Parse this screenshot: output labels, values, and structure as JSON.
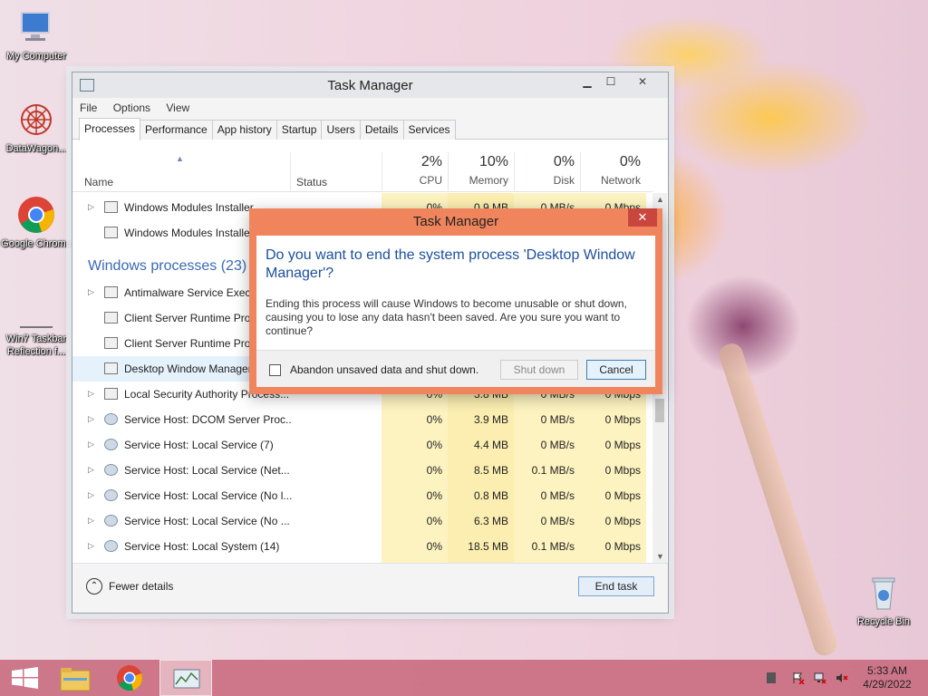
{
  "desktop": {
    "icons": [
      {
        "label": "My Computer",
        "icon": "computer-icon"
      },
      {
        "label": "DataWagon...",
        "icon": "datawagon-icon"
      },
      {
        "label": "Google Chrome",
        "icon": "chrome-icon"
      },
      {
        "label": "Win7 Taskbar Reflection f...",
        "icon": "shortcut-icon"
      },
      {
        "label": "Recycle Bin",
        "icon": "recycle-bin-icon"
      }
    ]
  },
  "taskmanager": {
    "title": "Task Manager",
    "window_buttons": {
      "minimize": "▁",
      "maximize": "☐",
      "close": "✕"
    },
    "menu": [
      "File",
      "Options",
      "View"
    ],
    "tabs": [
      "Processes",
      "Performance",
      "App history",
      "Startup",
      "Users",
      "Details",
      "Services"
    ],
    "active_tab": "Processes",
    "columns": {
      "name": "Name",
      "status": "Status",
      "cpu": {
        "pct": "2%",
        "label": "CPU"
      },
      "memory": {
        "pct": "10%",
        "label": "Memory"
      },
      "disk": {
        "pct": "0%",
        "label": "Disk"
      },
      "network": {
        "pct": "0%",
        "label": "Network"
      }
    },
    "group_header": "Windows processes (23)",
    "rows": [
      {
        "name": "Windows Modules Installer",
        "expand": "▷",
        "cpu": "0%",
        "mem": "0.9 MB",
        "disk": "0 MB/s",
        "net": "0 Mbps"
      },
      {
        "name": "Windows Modules Installer",
        "expand": "",
        "cpu": "",
        "mem": "",
        "disk": "",
        "net": ""
      },
      {
        "name": "Antimalware Service Executable",
        "expand": "▷",
        "cpu": "",
        "mem": "",
        "disk": "",
        "net": ""
      },
      {
        "name": "Client Server Runtime Process",
        "expand": "",
        "cpu": "",
        "mem": "",
        "disk": "",
        "net": ""
      },
      {
        "name": "Client Server Runtime Process",
        "expand": "",
        "cpu": "",
        "mem": "",
        "disk": "",
        "net": ""
      },
      {
        "name": "Desktop Window Manager",
        "expand": "",
        "cpu": "",
        "mem": "",
        "disk": "",
        "net": ""
      },
      {
        "name": "Local Security Authority Process...",
        "expand": "▷",
        "cpu": "0%",
        "mem": "3.8 MB",
        "disk": "0 MB/s",
        "net": "0 Mbps"
      },
      {
        "name": "Service Host: DCOM Server Proc...",
        "expand": "▷",
        "cpu": "0%",
        "mem": "3.9 MB",
        "disk": "0 MB/s",
        "net": "0 Mbps"
      },
      {
        "name": "Service Host: Local Service (7)",
        "expand": "▷",
        "cpu": "0%",
        "mem": "4.4 MB",
        "disk": "0 MB/s",
        "net": "0 Mbps"
      },
      {
        "name": "Service Host: Local Service (Net...",
        "expand": "▷",
        "cpu": "0%",
        "mem": "8.5 MB",
        "disk": "0.1 MB/s",
        "net": "0 Mbps"
      },
      {
        "name": "Service Host: Local Service (No l...",
        "expand": "▷",
        "cpu": "0%",
        "mem": "0.8 MB",
        "disk": "0 MB/s",
        "net": "0 Mbps"
      },
      {
        "name": "Service Host: Local Service (No ...",
        "expand": "▷",
        "cpu": "0%",
        "mem": "6.3 MB",
        "disk": "0 MB/s",
        "net": "0 Mbps"
      },
      {
        "name": "Service Host: Local System (14)",
        "expand": "▷",
        "cpu": "0%",
        "mem": "18.5 MB",
        "disk": "0.1 MB/s",
        "net": "0 Mbps"
      }
    ],
    "footer": {
      "fewer_details": "Fewer details",
      "end_task": "End task"
    }
  },
  "dialog": {
    "title": "Task Manager",
    "close": "✕",
    "question": "Do you want to end the system process 'Desktop Window Manager'?",
    "detail": "Ending this process will cause Windows to become unusable or shut down, causing you to lose any data hasn't been saved. Are you sure you want to continue?",
    "checkbox_label": "Abandon unsaved data and shut down.",
    "shutdown_button": "Shut down",
    "cancel_button": "Cancel"
  },
  "taskbar": {
    "time": "5:33 AM",
    "date": "4/29/2022"
  }
}
